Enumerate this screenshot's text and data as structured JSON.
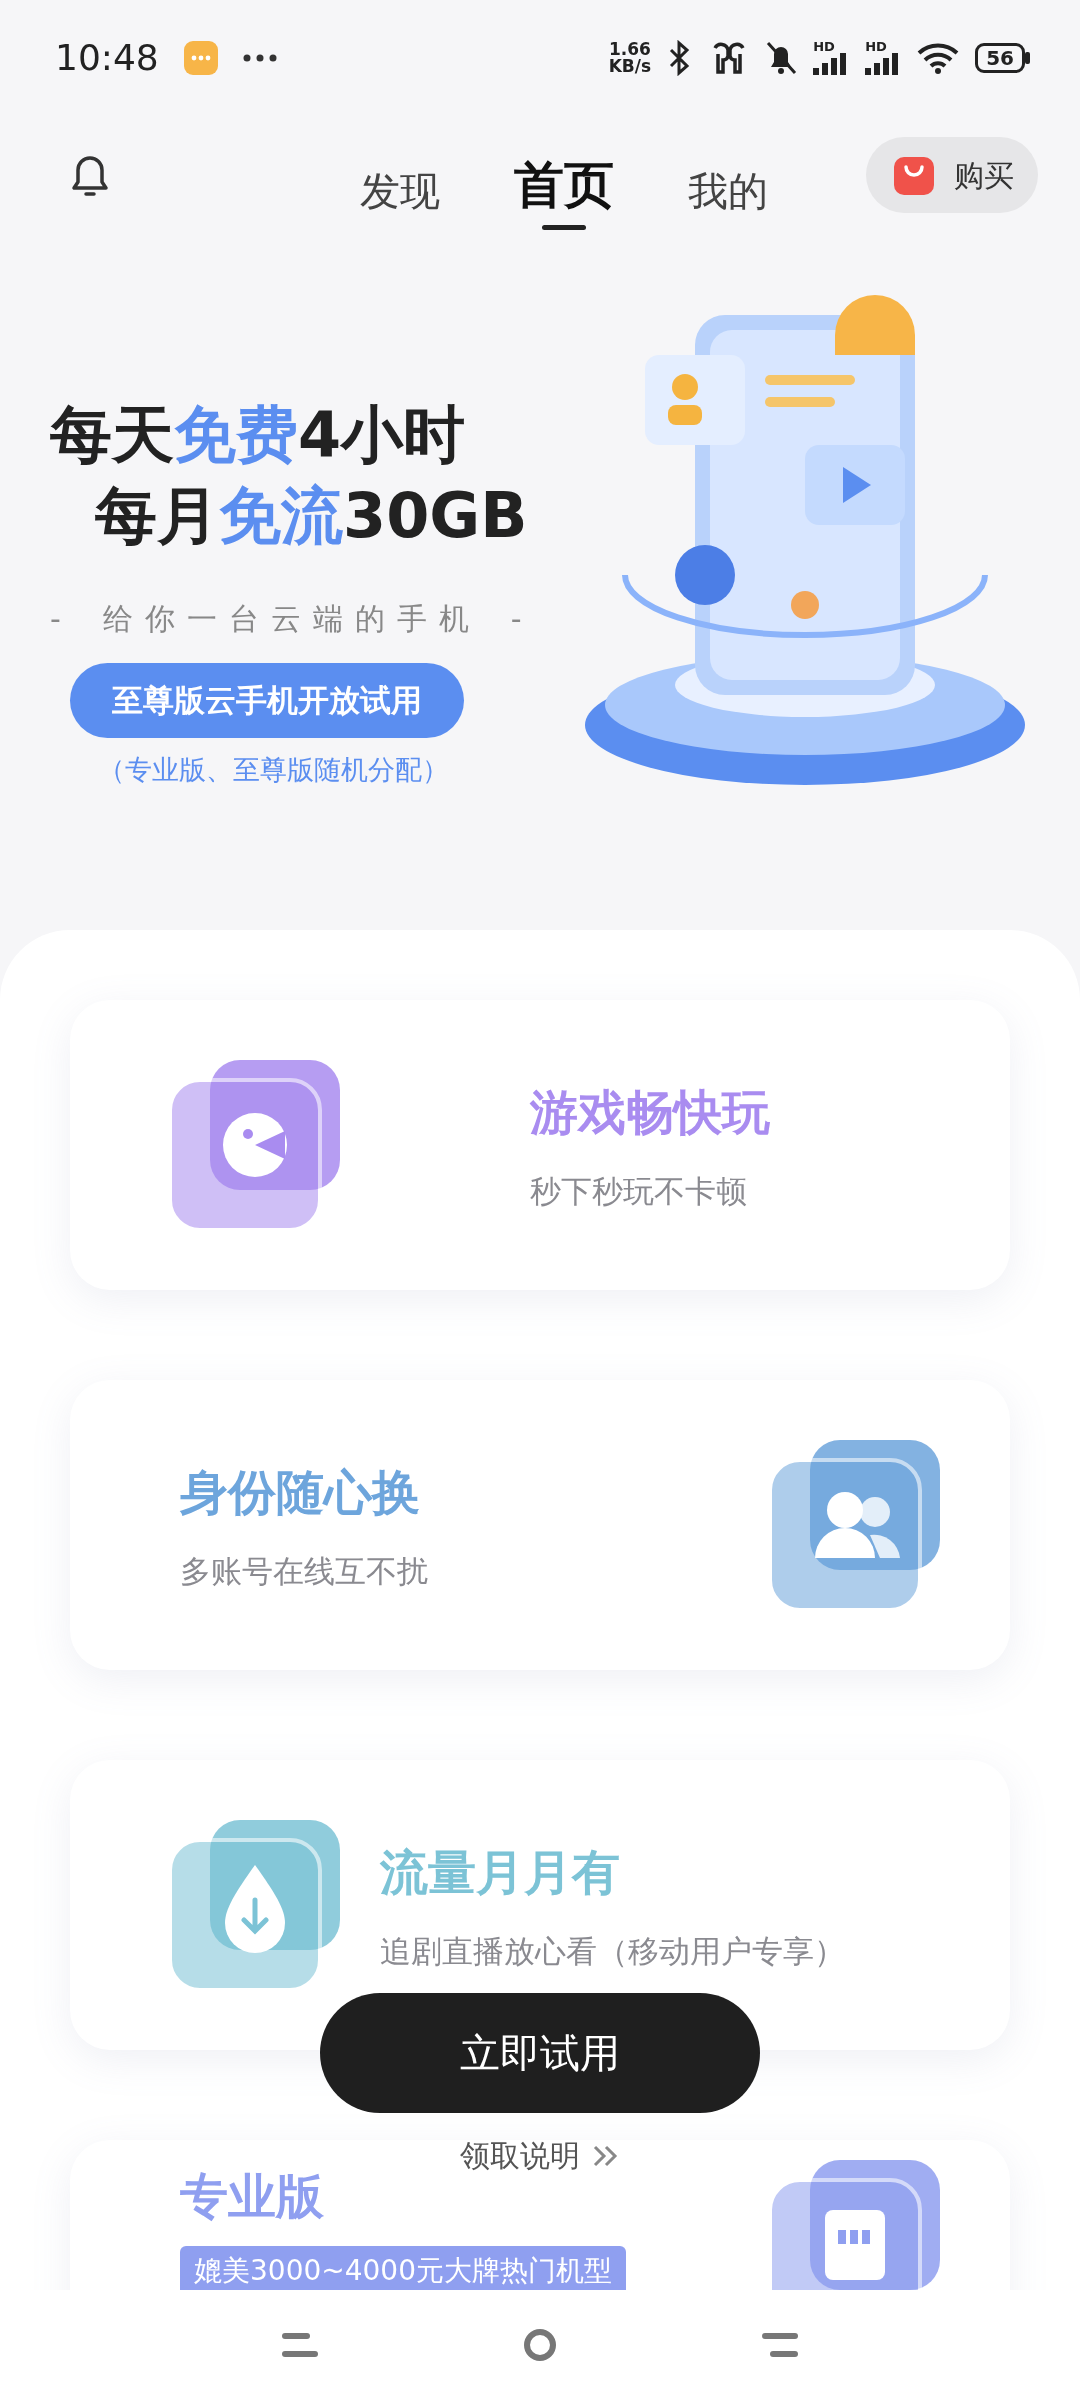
{
  "status_bar": {
    "time": "10:48",
    "net_speed_value": "1.66",
    "net_speed_unit": "KB/s",
    "sim1_label": "HD",
    "sim2_label": "HD",
    "battery": "56"
  },
  "tabs": [
    {
      "label": "发现",
      "selected": false
    },
    {
      "label": "首页",
      "selected": true
    },
    {
      "label": "我的",
      "selected": false
    }
  ],
  "buy_button": "购买",
  "banner": {
    "line1": "每天**免费**4小时",
    "line2": "每月**免流**30GB",
    "tagline": "给你一台云端的手机",
    "dash": "-",
    "pill": "至尊版云手机开放试用",
    "note": "（专业版、至尊版随机分配）"
  },
  "features": [
    {
      "kind": "game",
      "icon_right": false,
      "title": "游戏畅快玩",
      "subtitle": "秒下秒玩不卡顿",
      "color": "#a98cf0"
    },
    {
      "kind": "users",
      "icon_right": true,
      "title": "身份随心换",
      "subtitle": "多账号在线互不扰",
      "color": "#6da5dc"
    },
    {
      "kind": "drop",
      "icon_right": false,
      "title": "流量月月有",
      "subtitle": "追剧直播放心看（移动用户专享）",
      "color": "#7cc3d6"
    },
    {
      "kind": "sim",
      "icon_right": true,
      "title": "专业版",
      "tag": "媲美3000~4000元大牌热门机型",
      "color": "#8f9ff0"
    }
  ],
  "try_button": "立即试用",
  "info_link": "领取说明"
}
